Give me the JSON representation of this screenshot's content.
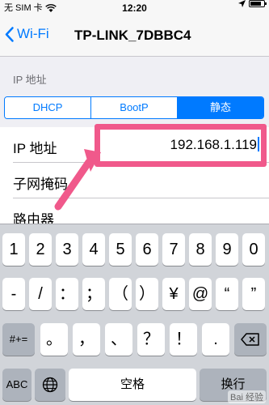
{
  "status_bar": {
    "carrier": "无 SIM 卡",
    "time": "12:20",
    "battery_level": 0.8
  },
  "nav": {
    "back_label": "Wi-Fi",
    "title": "TP-LINK_7DBBC4"
  },
  "section": {
    "header": "IP 地址"
  },
  "segmented": {
    "options": [
      "DHCP",
      "BootP",
      "静态"
    ],
    "selected": "静态"
  },
  "rows": [
    {
      "label": "IP 地址",
      "value": "192.168.1.119"
    },
    {
      "label": "子网掩码",
      "value": ""
    },
    {
      "label": "路由器",
      "value": ""
    }
  ],
  "keyboard": {
    "row1": [
      "1",
      "2",
      "3",
      "4",
      "5",
      "6",
      "7",
      "8",
      "9",
      "0"
    ],
    "row2": [
      "-",
      "/",
      "：",
      "；",
      "（",
      "）",
      "¥",
      "@",
      "“",
      "”"
    ],
    "row3_left": "#+=",
    "row3": [
      "。",
      "，",
      "、",
      "？",
      "！",
      "."
    ],
    "backspace_icon": "backspace-icon",
    "abc": "ABC",
    "globe_icon": "globe-icon",
    "space": "空格",
    "enter": "换行"
  },
  "watermark": "Bai 经验",
  "colors": {
    "accent": "#007aff",
    "highlight": "#f0598b"
  }
}
